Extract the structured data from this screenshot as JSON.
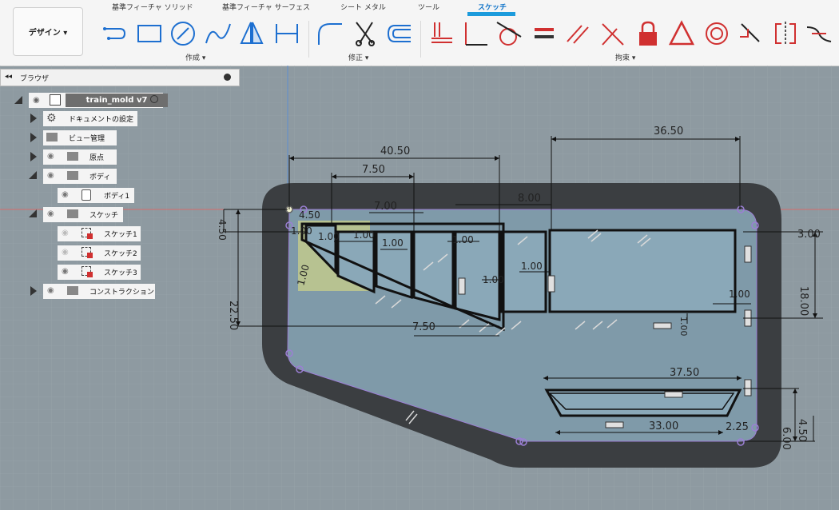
{
  "design_menu": {
    "label": "デザイン ▾"
  },
  "tabs": [
    {
      "label": "基準フィーチャ ソリッド"
    },
    {
      "label": "基準フィーチャ サーフェス"
    },
    {
      "label": "シート メタル"
    },
    {
      "label": "ツール"
    },
    {
      "label": "スケッチ"
    }
  ],
  "groups": {
    "create": "作成 ▾",
    "modify": "修正 ▾",
    "constraints": "拘束 ▾"
  },
  "browser": {
    "title": "ブラウザ",
    "root": "train_mold v7",
    "items": [
      {
        "label": "ドキュメントの設定"
      },
      {
        "label": "ビュー管理"
      },
      {
        "label": "原点"
      },
      {
        "label": "ボディ"
      },
      {
        "label": "ボディ1"
      },
      {
        "label": "スケッチ"
      },
      {
        "label": "スケッチ1"
      },
      {
        "label": "スケッチ2"
      },
      {
        "label": "スケッチ3"
      },
      {
        "label": "コンストラクション"
      }
    ]
  },
  "dimensions": {
    "d36_50": "36.50",
    "d40_50": "40.50",
    "d7_50a": "7.50",
    "d8_00": "8.00",
    "d7_00": "7.00",
    "d4_50a": "4.50",
    "d4_50b": "4.50",
    "d1_00a": "1.00",
    "d1_00b": "1.00",
    "d1_00c": "1.00",
    "d1_00d": "1.00",
    "d1_00e": "1.00",
    "d1_00f": "1.00",
    "d1_00g": "1.00",
    "d1_00h": "1.00",
    "d1_00i": "1.00",
    "d1_00j": "1.00",
    "d3_00": "3.00",
    "d18_00": "18.00",
    "d22_50": "22.50",
    "d7_50b": "7.50",
    "d37_50": "37.50",
    "d33_00": "33.00",
    "d2_25": "2.25",
    "d4_50c": "4.50",
    "d6_00": "6.00"
  },
  "colors": {
    "accent": "#1c9bdc",
    "canvas": "#8e9aa1",
    "body": "#3a3d40",
    "sketch_fill": "#7f9aa9",
    "profile": "#9b7fd4"
  }
}
